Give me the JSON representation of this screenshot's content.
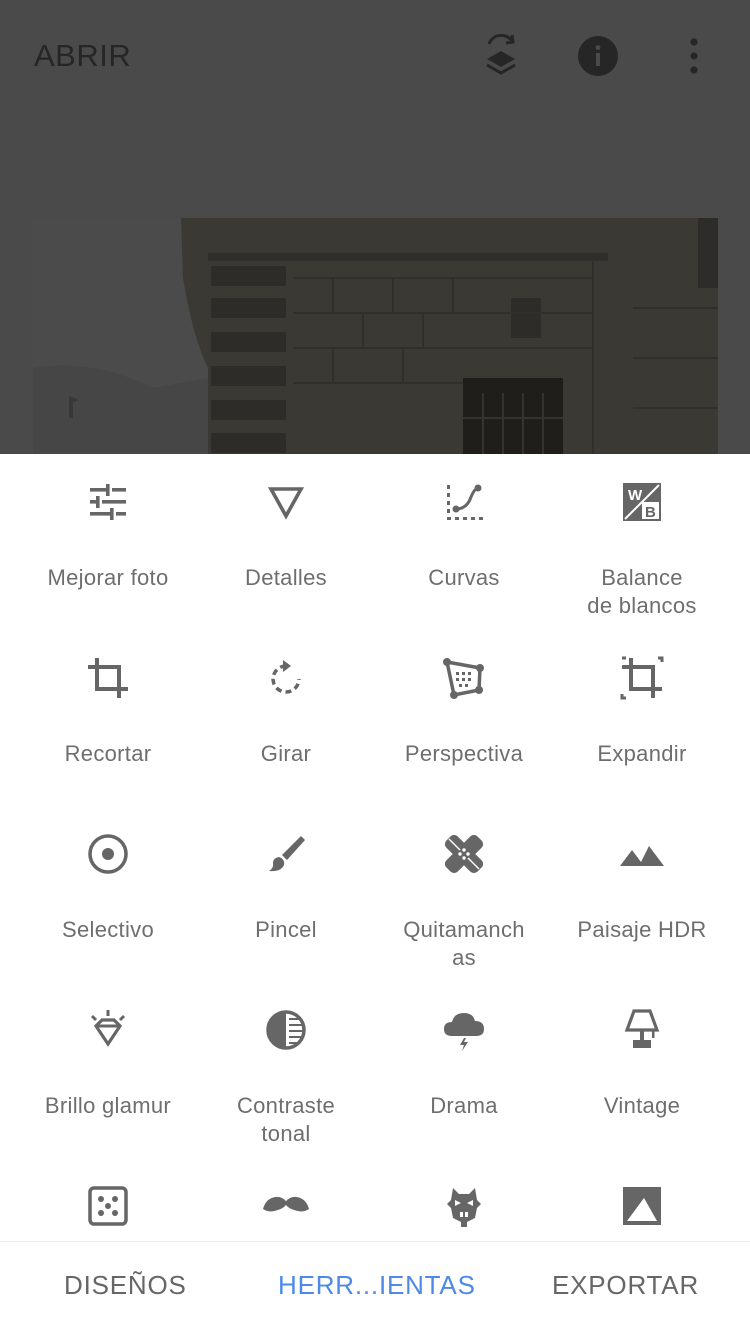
{
  "header": {
    "open_label": "ABRIR",
    "icons": [
      "layers-icon",
      "info-icon",
      "more-vert-icon"
    ]
  },
  "tools": [
    {
      "label": "Mejorar foto",
      "icon": "tune-icon"
    },
    {
      "label": "Detalles",
      "icon": "details-triangle-icon"
    },
    {
      "label": "Curvas",
      "icon": "curves-icon"
    },
    {
      "label": "Balance\nde blancos",
      "icon": "white-balance-icon"
    },
    {
      "label": "Recortar",
      "icon": "crop-icon"
    },
    {
      "label": "Girar",
      "icon": "rotate-icon"
    },
    {
      "label": "Perspectiva",
      "icon": "perspective-icon"
    },
    {
      "label": "Expandir",
      "icon": "expand-icon"
    },
    {
      "label": "Selectivo",
      "icon": "selective-icon"
    },
    {
      "label": "Pincel",
      "icon": "brush-icon"
    },
    {
      "label": "Quitamanch\nas",
      "icon": "healing-icon"
    },
    {
      "label": "Paisaje HDR",
      "icon": "hdr-landscape-icon"
    },
    {
      "label": "Brillo glamur",
      "icon": "glamour-glow-icon"
    },
    {
      "label": "Contraste\ntonal",
      "icon": "tonal-contrast-icon"
    },
    {
      "label": "Drama",
      "icon": "drama-icon"
    },
    {
      "label": "Vintage",
      "icon": "vintage-lamp-icon"
    },
    {
      "label": "",
      "icon": "grainy-film-icon"
    },
    {
      "label": "",
      "icon": "retrolux-mustache-icon"
    },
    {
      "label": "",
      "icon": "grunge-icon"
    },
    {
      "label": "",
      "icon": "black-white-icon"
    }
  ],
  "bottom_nav": {
    "looks": "DISEÑOS",
    "tools": "HERR...IENTAS",
    "export": "EXPORTAR"
  },
  "colors": {
    "accent": "#4d8ae8",
    "icon_gray": "#666666",
    "label_gray": "#6e6e6e",
    "overlay": "#4a4a4a"
  }
}
